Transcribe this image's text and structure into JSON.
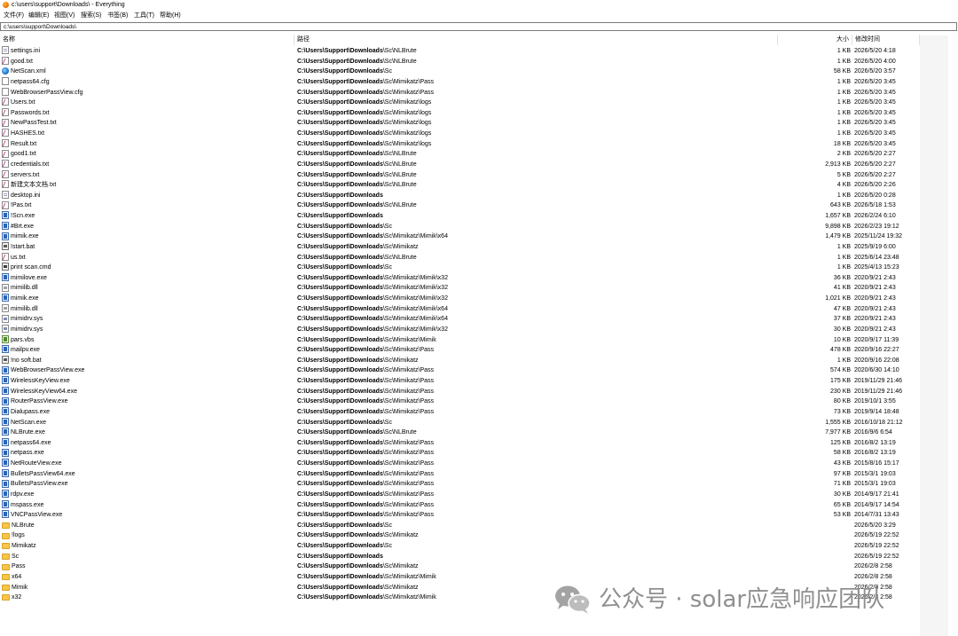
{
  "window": {
    "title": "c:\\users\\support\\Downloads\\ - Everything"
  },
  "menu": [
    "文件(F)",
    "编辑(E)",
    "视图(V)",
    "搜索(S)",
    "书签(B)",
    "工具(T)",
    "帮助(H)"
  ],
  "search": {
    "value": "c:\\users\\support\\Downloads\\"
  },
  "columns": {
    "name": "名称",
    "path": "路径",
    "size": "大小",
    "modified": "修改时间"
  },
  "rows": [
    {
      "name": "settings.ini",
      "icon": "ini",
      "path_bold": "C:\\Users\\Support\\Downloads",
      "path_rest": "\\Sc\\NLBrute",
      "size": "1 KB",
      "date": "2026/5/20 4:18"
    },
    {
      "name": "good.txt",
      "icon": "txt",
      "path_bold": "C:\\Users\\Support\\Downloads",
      "path_rest": "\\Sc\\NLBrute",
      "size": "1 KB",
      "date": "2026/5/20 4:00"
    },
    {
      "name": "NetScan.xml",
      "icon": "xml",
      "path_bold": "C:\\Users\\Support\\Downloads",
      "path_rest": "\\Sc",
      "size": "58 KB",
      "date": "2026/5/20 3:57"
    },
    {
      "name": "netpass64.cfg",
      "icon": "cfg",
      "path_bold": "C:\\Users\\Support\\Downloads",
      "path_rest": "\\Sc\\Mimikatz\\Pass",
      "size": "1 KB",
      "date": "2026/5/20 3:45"
    },
    {
      "name": "WebBrowserPassView.cfg",
      "icon": "cfg",
      "path_bold": "C:\\Users\\Support\\Downloads",
      "path_rest": "\\Sc\\Mimikatz\\Pass",
      "size": "1 KB",
      "date": "2026/5/20 3:45"
    },
    {
      "name": "Users.txt",
      "icon": "txt",
      "path_bold": "C:\\Users\\Support\\Downloads",
      "path_rest": "\\Sc\\Mimikatz\\logs",
      "size": "1 KB",
      "date": "2026/5/20 3:45"
    },
    {
      "name": "Passwords.txt",
      "icon": "txt",
      "path_bold": "C:\\Users\\Support\\Downloads",
      "path_rest": "\\Sc\\Mimikatz\\logs",
      "size": "1 KB",
      "date": "2026/5/20 3:45"
    },
    {
      "name": "NewPassTest.txt",
      "icon": "txt",
      "path_bold": "C:\\Users\\Support\\Downloads",
      "path_rest": "\\Sc\\Mimikatz\\logs",
      "size": "1 KB",
      "date": "2026/5/20 3:45"
    },
    {
      "name": "HASHES.txt",
      "icon": "txt",
      "path_bold": "C:\\Users\\Support\\Downloads",
      "path_rest": "\\Sc\\Mimikatz\\logs",
      "size": "1 KB",
      "date": "2026/5/20 3:45"
    },
    {
      "name": "Result.txt",
      "icon": "txt",
      "path_bold": "C:\\Users\\Support\\Downloads",
      "path_rest": "\\Sc\\Mimikatz\\logs",
      "size": "18 KB",
      "date": "2026/5/20 3:45"
    },
    {
      "name": "good1.txt",
      "icon": "txt",
      "path_bold": "C:\\Users\\Support\\Downloads",
      "path_rest": "\\Sc\\NLBrute",
      "size": "2 KB",
      "date": "2026/5/20 2:27"
    },
    {
      "name": "credentials.txt",
      "icon": "txt",
      "path_bold": "C:\\Users\\Support\\Downloads",
      "path_rest": "\\Sc\\NLBrute",
      "size": "2,913 KB",
      "date": "2026/5/20 2:27"
    },
    {
      "name": "servers.txt",
      "icon": "txt",
      "path_bold": "C:\\Users\\Support\\Downloads",
      "path_rest": "\\Sc\\NLBrute",
      "size": "5 KB",
      "date": "2026/5/20 2:27"
    },
    {
      "name": "新建文本文档.txt",
      "icon": "txt",
      "path_bold": "C:\\Users\\Support\\Downloads",
      "path_rest": "\\Sc\\NLBrute",
      "size": "4 KB",
      "date": "2026/5/20 2:26"
    },
    {
      "name": "desktop.ini",
      "icon": "ini",
      "path_bold": "C:\\Users\\Support\\Downloads",
      "path_rest": "",
      "size": "1 KB",
      "date": "2026/5/20 0:28"
    },
    {
      "name": "!Pas.txt",
      "icon": "txt",
      "path_bold": "C:\\Users\\Support\\Downloads",
      "path_rest": "\\Sc\\NLBrute",
      "size": "643 KB",
      "date": "2026/5/18 1:53"
    },
    {
      "name": "!Scn.exe",
      "icon": "exe",
      "path_bold": "C:\\Users\\Support\\Downloads",
      "path_rest": "",
      "size": "1,657 KB",
      "date": "2026/2/24 6:10"
    },
    {
      "name": "#Brt.exe",
      "icon": "exe",
      "path_bold": "C:\\Users\\Support\\Downloads",
      "path_rest": "\\Sc",
      "size": "9,898 KB",
      "date": "2026/2/23 19:12"
    },
    {
      "name": "mimik.exe",
      "icon": "exe",
      "path_bold": "C:\\Users\\Support\\Downloads",
      "path_rest": "\\Sc\\Mimikatz\\Mimik\\x64",
      "size": "1,479 KB",
      "date": "2025/11/24 19:32"
    },
    {
      "name": "!start.bat",
      "icon": "bat",
      "path_bold": "C:\\Users\\Support\\Downloads",
      "path_rest": "\\Sc\\Mimikatz",
      "size": "1 KB",
      "date": "2025/9/19 6:00"
    },
    {
      "name": "us.txt",
      "icon": "txt",
      "path_bold": "C:\\Users\\Support\\Downloads",
      "path_rest": "\\Sc\\NLBrute",
      "size": "1 KB",
      "date": "2025/6/14 23:48"
    },
    {
      "name": "print scan.cmd",
      "icon": "cmd",
      "path_bold": "C:\\Users\\Support\\Downloads",
      "path_rest": "\\Sc",
      "size": "1 KB",
      "date": "2025/4/13 15:23"
    },
    {
      "name": "mimilove.exe",
      "icon": "exe",
      "path_bold": "C:\\Users\\Support\\Downloads",
      "path_rest": "\\Sc\\Mimikatz\\Mimik\\x32",
      "size": "36 KB",
      "date": "2020/9/21 2:43"
    },
    {
      "name": "mimilib.dll",
      "icon": "dll",
      "path_bold": "C:\\Users\\Support\\Downloads",
      "path_rest": "\\Sc\\Mimikatz\\Mimik\\x32",
      "size": "41 KB",
      "date": "2020/9/21 2:43"
    },
    {
      "name": "mimik.exe",
      "icon": "exe",
      "path_bold": "C:\\Users\\Support\\Downloads",
      "path_rest": "\\Sc\\Mimikatz\\Mimik\\x32",
      "size": "1,021 KB",
      "date": "2020/9/21 2:43"
    },
    {
      "name": "mimilib.dll",
      "icon": "dll",
      "path_bold": "C:\\Users\\Support\\Downloads",
      "path_rest": "\\Sc\\Mimikatz\\Mimik\\x64",
      "size": "47 KB",
      "date": "2020/9/21 2:43"
    },
    {
      "name": "mimidrv.sys",
      "icon": "sys",
      "path_bold": "C:\\Users\\Support\\Downloads",
      "path_rest": "\\Sc\\Mimikatz\\Mimik\\x64",
      "size": "37 KB",
      "date": "2020/9/21 2:43"
    },
    {
      "name": "mimidrv.sys",
      "icon": "sys",
      "path_bold": "C:\\Users\\Support\\Downloads",
      "path_rest": "\\Sc\\Mimikatz\\Mimik\\x32",
      "size": "30 KB",
      "date": "2020/9/21 2:43"
    },
    {
      "name": "pars.vbs",
      "icon": "vbs",
      "path_bold": "C:\\Users\\Support\\Downloads",
      "path_rest": "\\Sc\\Mimikatz\\Mimik",
      "size": "10 KB",
      "date": "2020/9/17 11:39"
    },
    {
      "name": "mailpv.exe",
      "icon": "exe",
      "path_bold": "C:\\Users\\Support\\Downloads",
      "path_rest": "\\Sc\\Mimikatz\\Pass",
      "size": "478 KB",
      "date": "2020/9/16 22:27"
    },
    {
      "name": "!no soft.bat",
      "icon": "bat",
      "path_bold": "C:\\Users\\Support\\Downloads",
      "path_rest": "\\Sc\\Mimikatz",
      "size": "1 KB",
      "date": "2020/9/16 22:08"
    },
    {
      "name": "WebBrowserPassView.exe",
      "icon": "exe",
      "path_bold": "C:\\Users\\Support\\Downloads",
      "path_rest": "\\Sc\\Mimikatz\\Pass",
      "size": "574 KB",
      "date": "2020/6/30 14:10"
    },
    {
      "name": "WirelessKeyView.exe",
      "icon": "exe",
      "path_bold": "C:\\Users\\Support\\Downloads",
      "path_rest": "\\Sc\\Mimikatz\\Pass",
      "size": "175 KB",
      "date": "2019/11/29 21:46"
    },
    {
      "name": "WirelessKeyView64.exe",
      "icon": "exe",
      "path_bold": "C:\\Users\\Support\\Downloads",
      "path_rest": "\\Sc\\Mimikatz\\Pass",
      "size": "230 KB",
      "date": "2019/11/29 21:46"
    },
    {
      "name": "RouterPassView.exe",
      "icon": "exe",
      "path_bold": "C:\\Users\\Support\\Downloads",
      "path_rest": "\\Sc\\Mimikatz\\Pass",
      "size": "80 KB",
      "date": "2019/10/1 3:55"
    },
    {
      "name": "Dialupass.exe",
      "icon": "exe",
      "path_bold": "C:\\Users\\Support\\Downloads",
      "path_rest": "\\Sc\\Mimikatz\\Pass",
      "size": "73 KB",
      "date": "2019/9/14 18:48"
    },
    {
      "name": "NetScan.exe",
      "icon": "exe",
      "path_bold": "C:\\Users\\Support\\Downloads",
      "path_rest": "\\Sc",
      "size": "1,555 KB",
      "date": "2016/10/18 21:12"
    },
    {
      "name": "NLBrute.exe",
      "icon": "exe",
      "path_bold": "C:\\Users\\Support\\Downloads",
      "path_rest": "\\Sc\\NLBrute",
      "size": "7,977 KB",
      "date": "2016/9/6 6:54"
    },
    {
      "name": "netpass64.exe",
      "icon": "exe",
      "path_bold": "C:\\Users\\Support\\Downloads",
      "path_rest": "\\Sc\\Mimikatz\\Pass",
      "size": "125 KB",
      "date": "2016/8/2 13:19"
    },
    {
      "name": "netpass.exe",
      "icon": "exe",
      "path_bold": "C:\\Users\\Support\\Downloads",
      "path_rest": "\\Sc\\Mimikatz\\Pass",
      "size": "58 KB",
      "date": "2016/8/2 13:19"
    },
    {
      "name": "NetRouteView.exe",
      "icon": "exe",
      "path_bold": "C:\\Users\\Support\\Downloads",
      "path_rest": "\\Sc\\Mimikatz\\Pass",
      "size": "43 KB",
      "date": "2015/8/16 15:17"
    },
    {
      "name": "BulletsPassView64.exe",
      "icon": "exe",
      "path_bold": "C:\\Users\\Support\\Downloads",
      "path_rest": "\\Sc\\Mimikatz\\Pass",
      "size": "97 KB",
      "date": "2015/3/1 19:03"
    },
    {
      "name": "BulletsPassView.exe",
      "icon": "exe",
      "path_bold": "C:\\Users\\Support\\Downloads",
      "path_rest": "\\Sc\\Mimikatz\\Pass",
      "size": "71 KB",
      "date": "2015/3/1 19:03"
    },
    {
      "name": "rdpv.exe",
      "icon": "exe",
      "path_bold": "C:\\Users\\Support\\Downloads",
      "path_rest": "\\Sc\\Mimikatz\\Pass",
      "size": "30 KB",
      "date": "2014/9/17 21:41"
    },
    {
      "name": "mspass.exe",
      "icon": "exe",
      "path_bold": "C:\\Users\\Support\\Downloads",
      "path_rest": "\\Sc\\Mimikatz\\Pass",
      "size": "65 KB",
      "date": "2014/9/17 14:54"
    },
    {
      "name": "VNCPassView.exe",
      "icon": "exe",
      "path_bold": "C:\\Users\\Support\\Downloads",
      "path_rest": "\\Sc\\Mimikatz\\Pass",
      "size": "53 KB",
      "date": "2014/7/31 13:43"
    },
    {
      "name": "NLBrute",
      "icon": "folder",
      "path_bold": "C:\\Users\\Support\\Downloads",
      "path_rest": "\\Sc",
      "size": "",
      "date": "2026/5/20 3:29"
    },
    {
      "name": "!logs",
      "icon": "folder",
      "path_bold": "C:\\Users\\Support\\Downloads",
      "path_rest": "\\Sc\\Mimikatz",
      "size": "",
      "date": "2026/5/19 22:52"
    },
    {
      "name": "Mimikatz",
      "icon": "folder",
      "path_bold": "C:\\Users\\Support\\Downloads",
      "path_rest": "\\Sc",
      "size": "",
      "date": "2026/5/19 22:52"
    },
    {
      "name": "Sc",
      "icon": "folder",
      "path_bold": "C:\\Users\\Support\\Downloads",
      "path_rest": "",
      "size": "",
      "date": "2026/5/19 22:52"
    },
    {
      "name": "Pass",
      "icon": "folder",
      "path_bold": "C:\\Users\\Support\\Downloads",
      "path_rest": "\\Sc\\Mimikatz",
      "size": "",
      "date": "2026/2/8 2:58"
    },
    {
      "name": "x64",
      "icon": "folder",
      "path_bold": "C:\\Users\\Support\\Downloads",
      "path_rest": "\\Sc\\Mimikatz\\Mimik",
      "size": "",
      "date": "2026/2/8 2:58"
    },
    {
      "name": "Mimik",
      "icon": "folder",
      "path_bold": "C:\\Users\\Support\\Downloads",
      "path_rest": "\\Sc\\Mimikatz",
      "size": "",
      "date": "2026/2/8 2:58"
    },
    {
      "name": "x32",
      "icon": "folder",
      "path_bold": "C:\\Users\\Support\\Downloads",
      "path_rest": "\\Sc\\Mimikatz\\Mimik",
      "size": "",
      "date": "2026/2/8 2:58"
    }
  ],
  "watermark": {
    "text": "公众号 · solar应急响应团队",
    "icon": "wechat-logo-icon"
  },
  "colors": {
    "folder": "#f8c64a",
    "exe": "#2d63b8",
    "txt_accent": "#c23a8a",
    "watermark": "#8f8f8f"
  }
}
